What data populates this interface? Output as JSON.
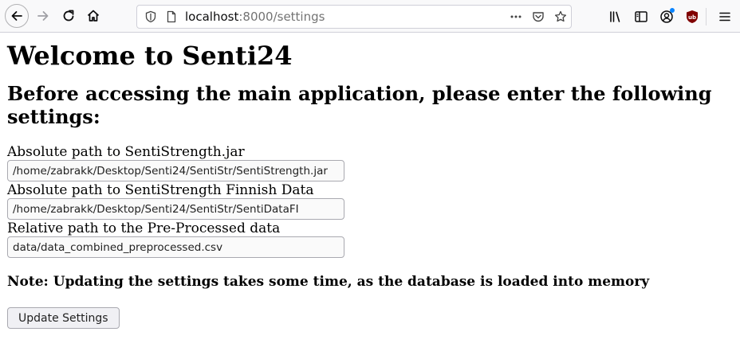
{
  "browser": {
    "url_host": "localhost",
    "url_port_path": ":8000/settings"
  },
  "page": {
    "title": "Welcome to Senti24",
    "subtitle": "Before accessing the main application, please enter the following settings:",
    "fields": [
      {
        "label": "Absolute path to SentiStrength.jar",
        "value": "/home/zabrakk/Desktop/Senti24/SentiStr/SentiStrength.jar"
      },
      {
        "label": "Absolute path to SentiStrength Finnish Data",
        "value": "/home/zabrakk/Desktop/Senti24/SentiStr/SentiDataFI"
      },
      {
        "label": "Relative path to the Pre-Processed data",
        "value": "data/data_combined_preprocessed.csv"
      }
    ],
    "note": "Note: Updating the settings takes some time, as the database is loaded into memory",
    "button_label": "Update Settings"
  },
  "colors": {
    "accent_badge": "#0a84ff",
    "ublock_red": "#800000"
  }
}
